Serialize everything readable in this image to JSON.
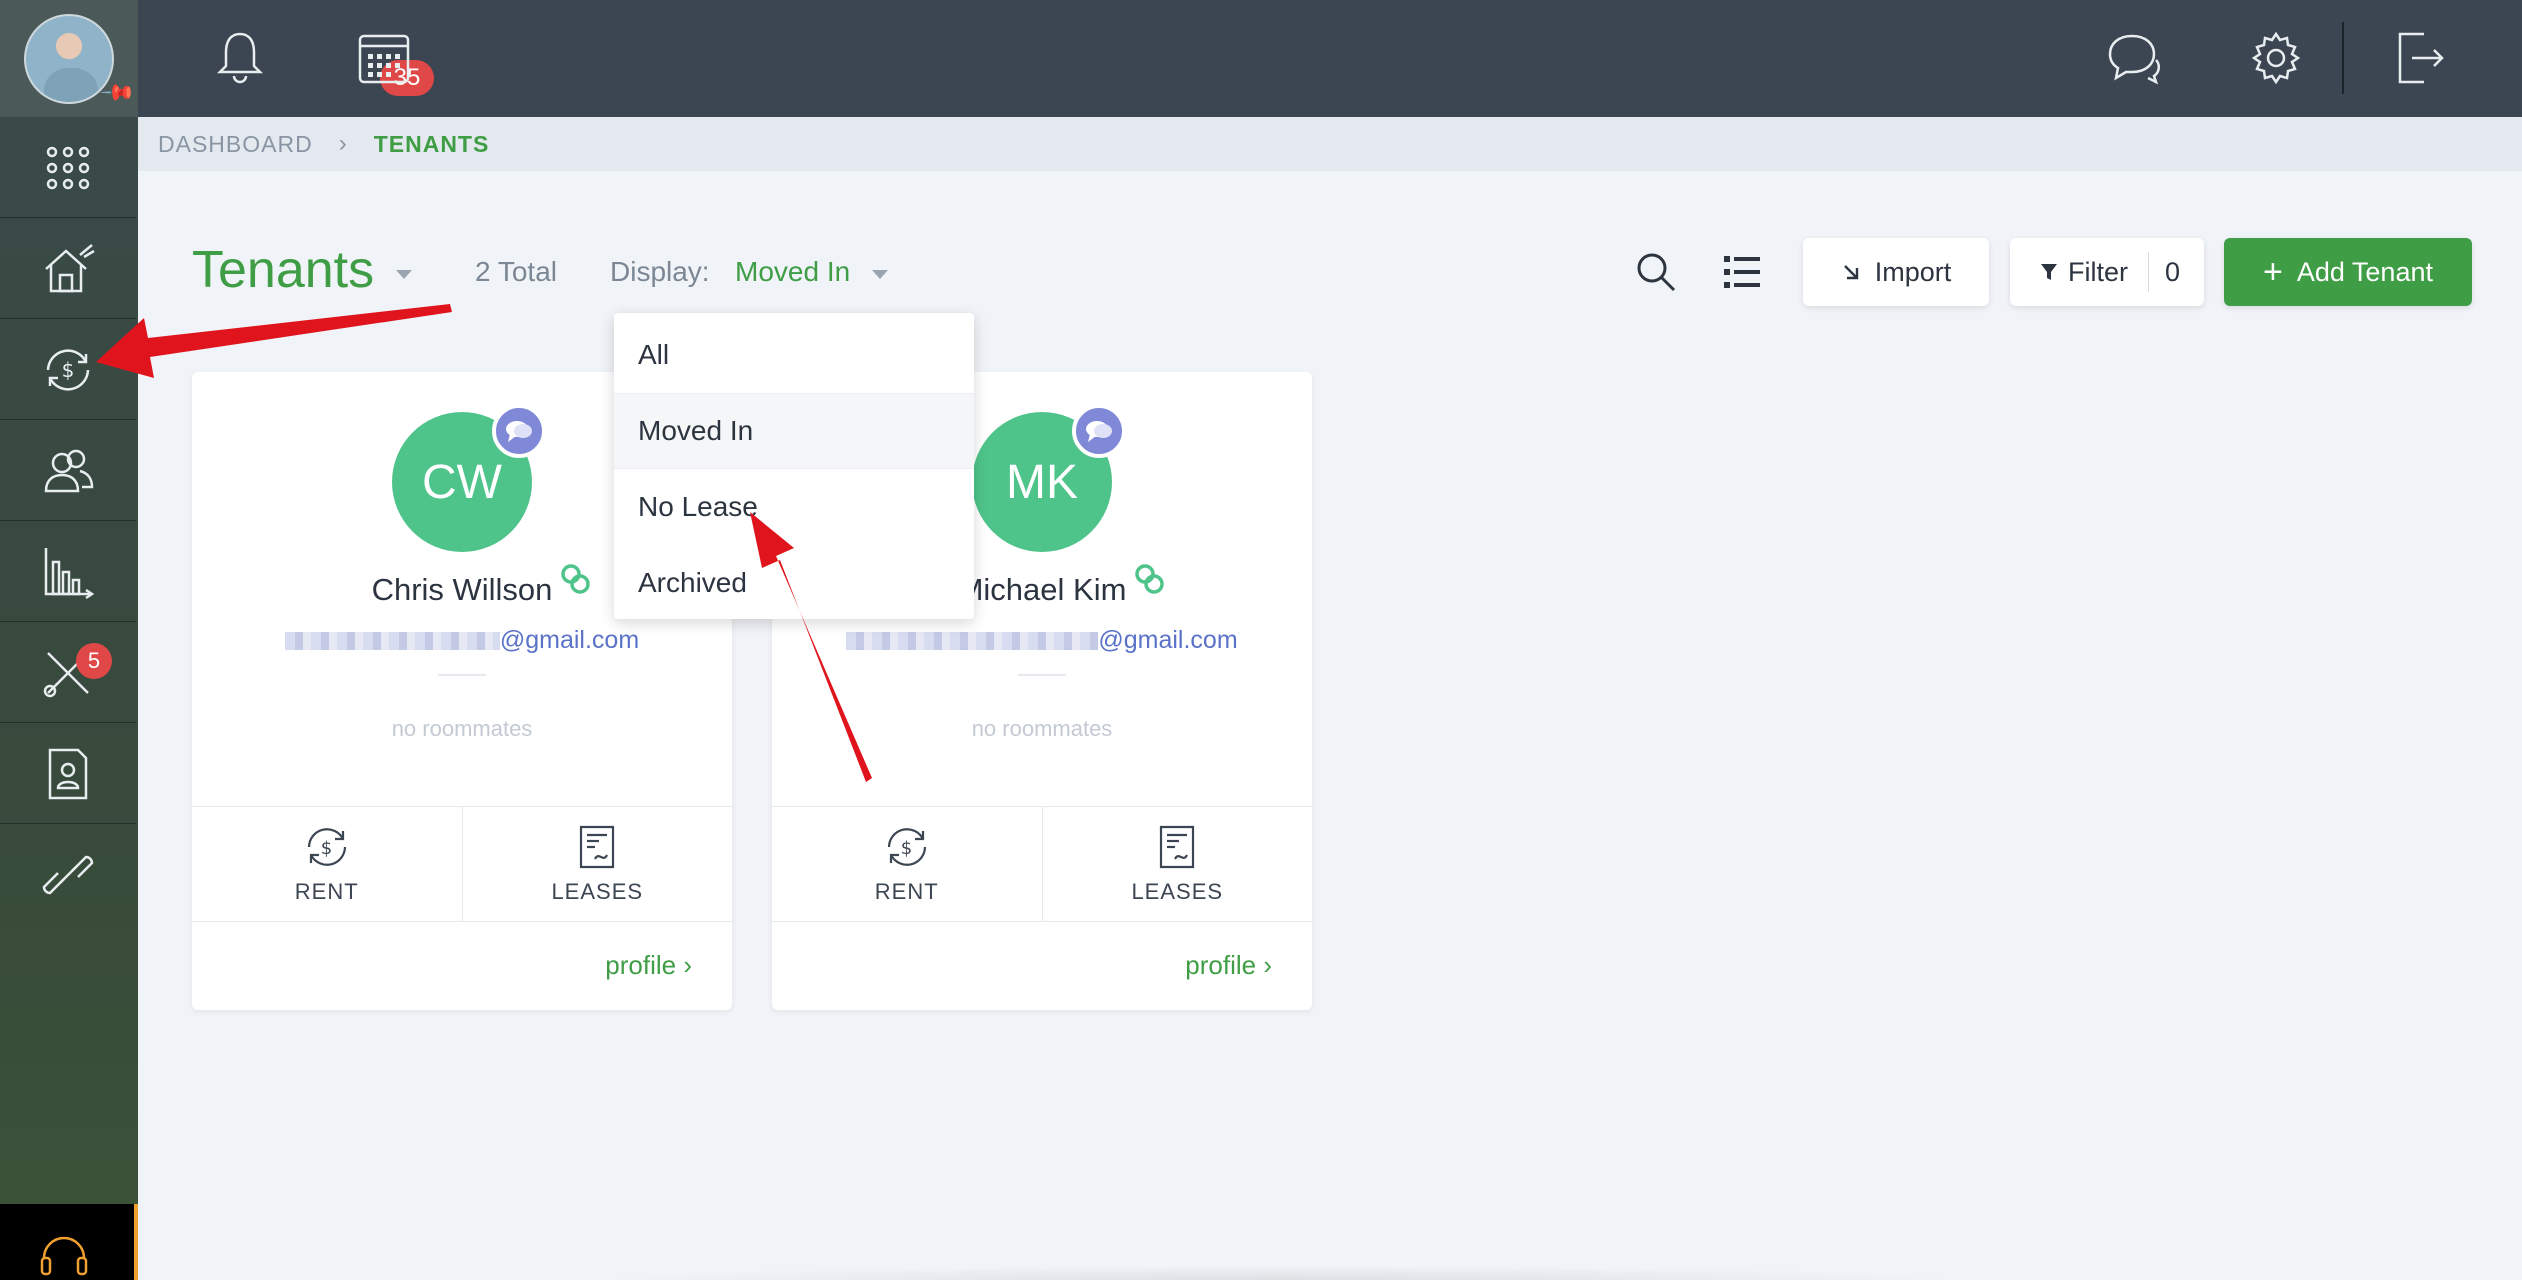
{
  "topbar": {
    "notifications_count": "35"
  },
  "sidebar": {
    "maintenance_badge": "5"
  },
  "breadcrumb": {
    "root": "DASHBOARD",
    "current": "TENANTS"
  },
  "header": {
    "title": "Tenants",
    "total": "2 Total",
    "display_label": "Display:",
    "display_value": "Moved In"
  },
  "toolbar": {
    "import_label": "Import",
    "filter_label": "Filter",
    "filter_count": "0",
    "add_label": "Add Tenant"
  },
  "dropdown": {
    "options": [
      "All",
      "Moved In",
      "No Lease",
      "Archived"
    ],
    "selected": "Moved In"
  },
  "tenants": [
    {
      "initials": "CW",
      "name": "Chris Willson",
      "email_domain": "@gmail.com",
      "roommates": "no roommates",
      "rent_label": "RENT",
      "leases_label": "LEASES",
      "profile_label": "profile ›"
    },
    {
      "initials": "MK",
      "name": "Michael Kim",
      "email_domain": "@gmail.com",
      "roommates": "no roommates",
      "rent_label": "RENT",
      "leases_label": "LEASES",
      "profile_label": "profile ›"
    }
  ],
  "colors": {
    "accent_green": "#3f9e45",
    "avatar_green": "#4ec48a",
    "badge_red": "#e04848",
    "chat_purple": "#7f89d8",
    "annotation_red": "#e0141c"
  },
  "icons": {
    "sidebar": [
      "apps-grid-icon",
      "property-house-icon",
      "rent-payment-icon",
      "tenants-people-icon",
      "reports-chart-icon",
      "maintenance-tools-icon",
      "leases-document-icon",
      "links-chain-icon",
      "support-headset-icon"
    ],
    "topbar": [
      "bell-icon",
      "calendar-icon",
      "chat-icon",
      "gear-icon",
      "logout-icon"
    ]
  }
}
